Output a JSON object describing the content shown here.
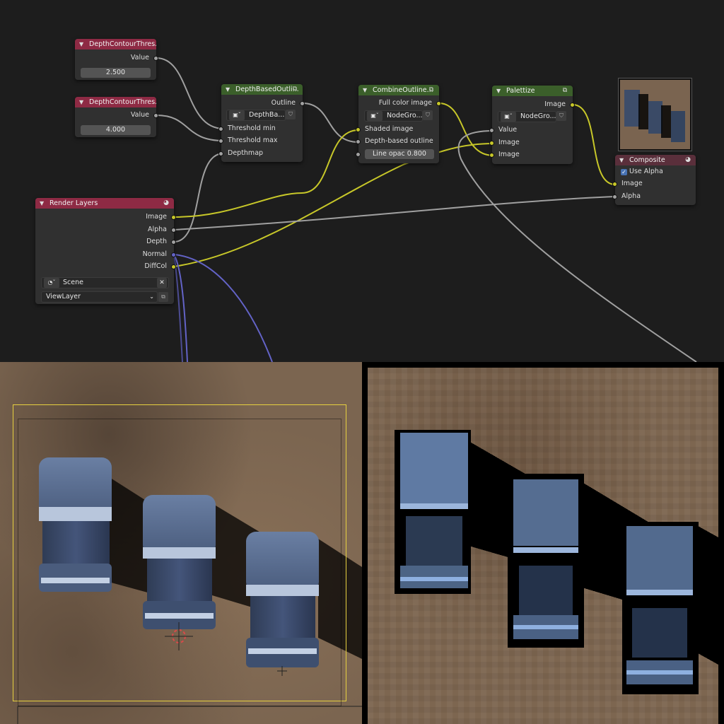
{
  "nodes": {
    "depth_min": {
      "title": "DepthContourThres...",
      "output": "Value",
      "value": "2.500"
    },
    "depth_max": {
      "title": "DepthContourThres...",
      "output": "Value",
      "value": "4.000"
    },
    "depth_outline": {
      "title": "DepthBasedOutli...",
      "output": "Outline",
      "group": "DepthBa...",
      "inputs": [
        "Threshold min",
        "Threshold max",
        "Depthmap"
      ]
    },
    "combine": {
      "title": "CombineOutline...",
      "output": "Full color image",
      "group": "NodeGro...",
      "inputs": [
        "Shaded image",
        "Depth-based outline"
      ],
      "line_opac_label": "Line opac",
      "line_opac_value": "0.800"
    },
    "palettize": {
      "title": "Palettize",
      "output": "Image",
      "group": "NodeGro...",
      "inputs": [
        "Value",
        "Image",
        "Image"
      ]
    },
    "render_layers": {
      "title": "Render Layers",
      "outputs": [
        "Image",
        "Alpha",
        "Depth",
        "Normal",
        "DiffCol"
      ],
      "scene": "Scene",
      "view_layer": "ViewLayer"
    },
    "composite": {
      "title": "Composite",
      "use_alpha_label": "Use Alpha",
      "use_alpha": true,
      "inputs": [
        "Image",
        "Alpha"
      ]
    }
  },
  "colors": {
    "editor_bg": "#1d1d1d",
    "node_bg": "#303030",
    "header_input": "#8e2a44",
    "header_group": "#3b5f2a",
    "header_output": "#5a2f3b",
    "socket_color": "#c7c729",
    "socket_value": "#a1a1a1",
    "socket_vector": "#6363c7",
    "camera_frame": "#e6d040"
  },
  "icons": {
    "collapse": "chevron-down-icon",
    "node_group": "node-group-icon",
    "scene": "scene-icon",
    "fake_user": "shield-icon",
    "clear": "close-icon",
    "view_layer": "view-layer-icon",
    "output": "composite-output-icon"
  }
}
